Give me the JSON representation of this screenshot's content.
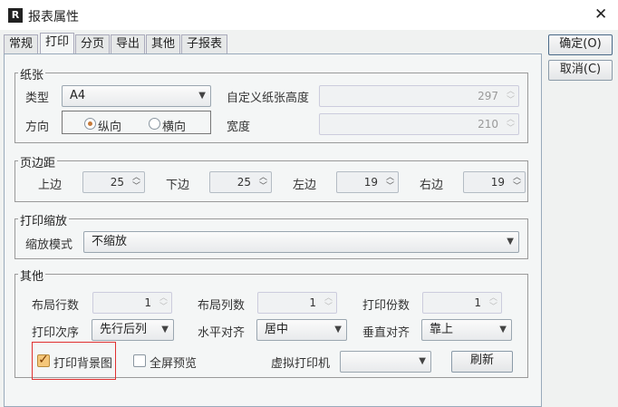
{
  "window": {
    "title": "报表属性",
    "icon": "report-icon",
    "close": "✕"
  },
  "tabs": [
    {
      "label": "常规"
    },
    {
      "label": "打印"
    },
    {
      "label": "分页"
    },
    {
      "label": "导出"
    },
    {
      "label": "其他"
    },
    {
      "label": "子报表"
    }
  ],
  "buttons": {
    "ok": "确定(O)",
    "cancel": "取消(C)",
    "refresh": "刷新"
  },
  "paper": {
    "title": "纸张",
    "type_label": "类型",
    "type_value": "A4",
    "orientation_label": "方向",
    "portrait": "纵向",
    "landscape": "横向",
    "orientation_selected": "纵向",
    "height_label": "自定义纸张高度",
    "height_value": "297",
    "width_label": "宽度",
    "width_value": "210"
  },
  "margins": {
    "title": "页边距",
    "top_label": "上边",
    "top": "25",
    "bottom_label": "下边",
    "bottom": "25",
    "left_label": "左边",
    "left": "19",
    "right_label": "右边",
    "right": "19"
  },
  "scaling": {
    "title": "打印缩放",
    "mode_label": "缩放模式",
    "mode_value": "不缩放"
  },
  "other": {
    "title": "其他",
    "rows_label": "布局行数",
    "rows": "1",
    "cols_label": "布局列数",
    "cols": "1",
    "copies_label": "打印份数",
    "copies": "1",
    "order_label": "打印次序",
    "order_value": "先行后列",
    "halign_label": "水平对齐",
    "halign_value": "居中",
    "valign_label": "垂直对齐",
    "valign_value": "靠上",
    "print_bg_label": "打印背景图",
    "print_bg_checked": true,
    "fullscreen_label": "全屏预览",
    "fullscreen_checked": false,
    "printer_label": "虚拟打印机",
    "printer_value": ""
  },
  "highlight_color": "#e03030"
}
